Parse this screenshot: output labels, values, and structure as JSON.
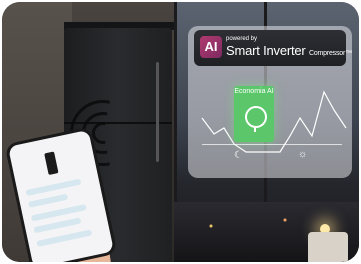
{
  "card": {
    "ai_label": "AI",
    "powered_by": "powered by",
    "brand": "Smart Inverter",
    "brand_sub": "Compressor™"
  },
  "economy": {
    "label": "Economia AI"
  },
  "icons": {
    "night": "moon-icon",
    "day": "sun-icon",
    "plug": "plug-icon"
  },
  "colors": {
    "ai_badge": "#9a3468",
    "economy_green": "#5cc76a",
    "fridge": "#222325"
  }
}
